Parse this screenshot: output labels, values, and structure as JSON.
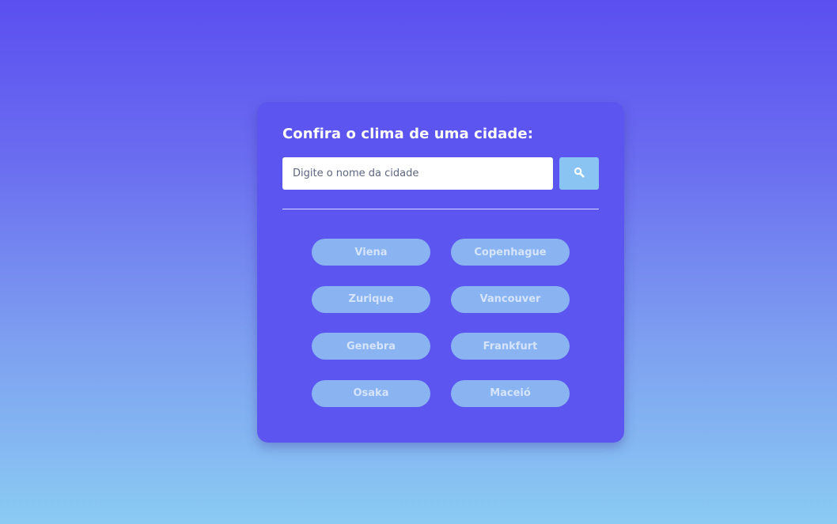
{
  "card": {
    "title": "Confira o clima de uma cidade:"
  },
  "search": {
    "placeholder": "Digite o nome da cidade",
    "button_icon": "search-icon"
  },
  "suggestions": [
    "Viena",
    "Copenhague",
    "Zurique",
    "Vancouver",
    "Genebra",
    "Frankfurt",
    "Osaka",
    "Maceió"
  ],
  "colors": {
    "background_top": "#5b4ff0",
    "background_bottom": "#8acbf3",
    "card": "#5c55ef",
    "search_button": "#8ac4f3",
    "city_button": "#89b4f1",
    "city_button_text": "#d5e4fb"
  }
}
